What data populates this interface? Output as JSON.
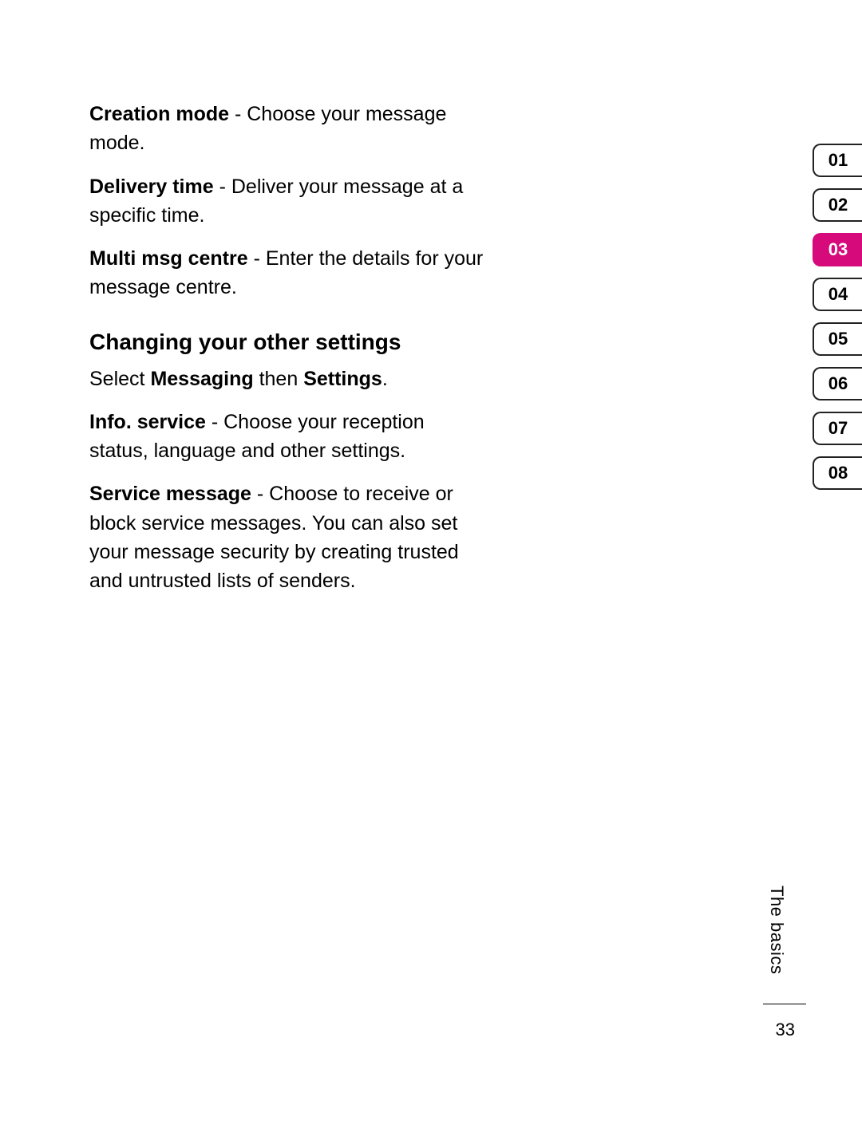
{
  "body": {
    "items": [
      {
        "term": "Creation mode",
        "desc": " - Choose your message mode."
      },
      {
        "term": "Delivery time",
        "desc": " - Deliver your message at a specific time."
      },
      {
        "term": "Multi msg centre",
        "desc": " - Enter the details for your message centre."
      }
    ],
    "heading": "Changing your other settings",
    "select_prefix": "Select ",
    "select_b1": "Messaging",
    "select_mid": " then ",
    "select_b2": "Settings",
    "select_suffix": ".",
    "items2": [
      {
        "term": "Info. service",
        "desc": " - Choose your reception status, language and other settings."
      },
      {
        "term": "Service message",
        "desc": " - Choose to receive or block service messages. You can also set your message security by creating trusted and untrusted lists of senders."
      }
    ]
  },
  "tabs": {
    "labels": [
      "01",
      "02",
      "03",
      "04",
      "05",
      "06",
      "07",
      "08"
    ],
    "active_index": 2
  },
  "footer": {
    "section": "The basics",
    "page": "33"
  }
}
